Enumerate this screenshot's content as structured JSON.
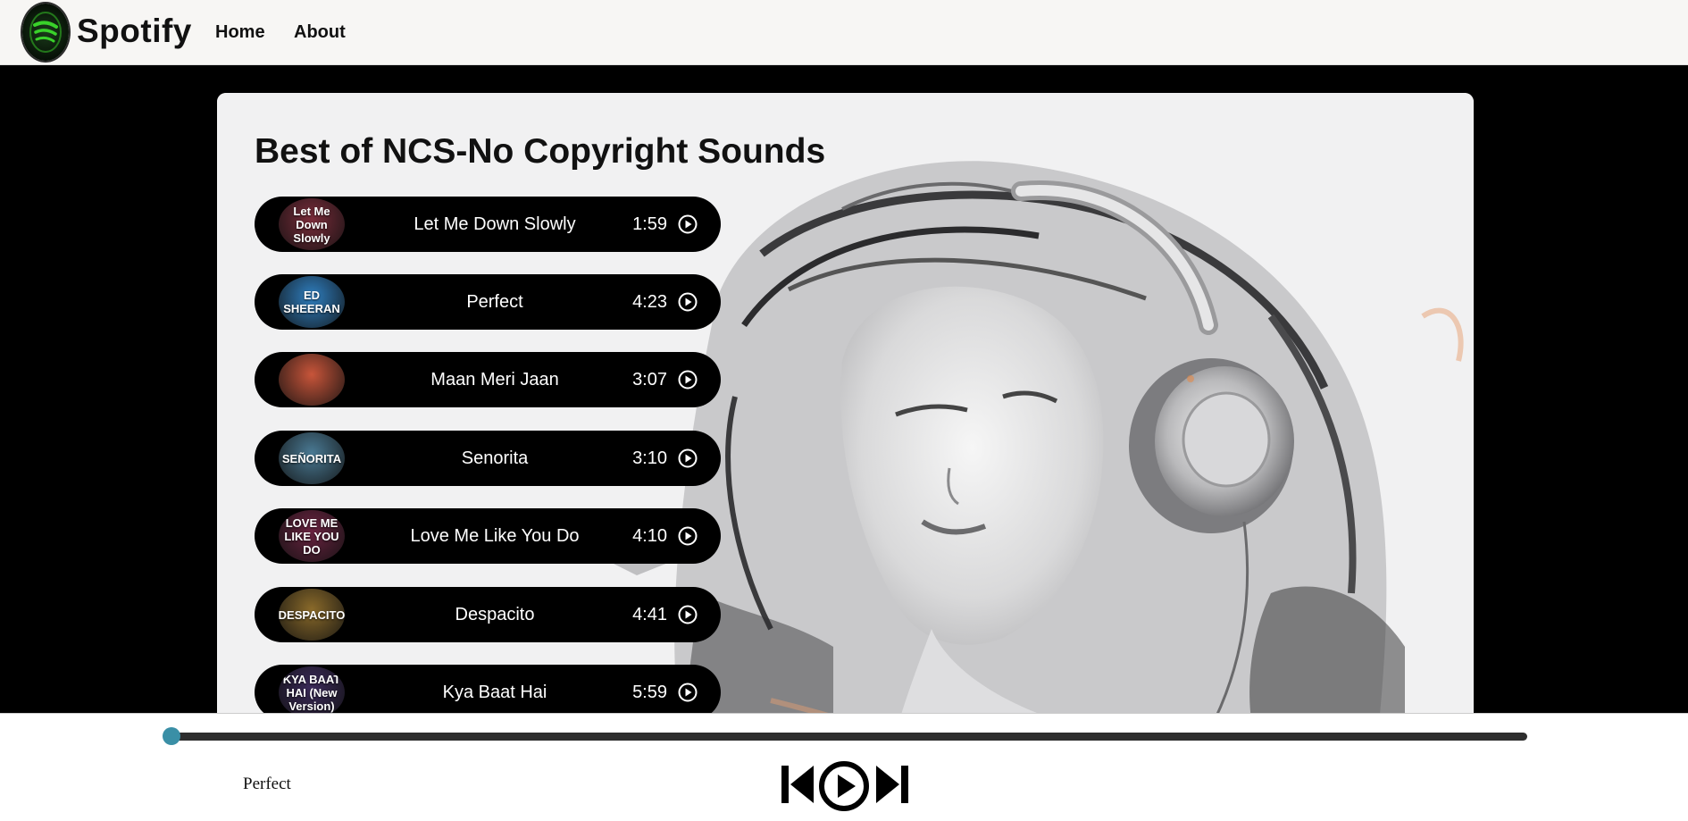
{
  "nav": {
    "brand": "Spotify",
    "links": [
      "Home",
      "About"
    ]
  },
  "main": {
    "heading": "Best of NCS-No Copyright Sounds",
    "songs": [
      {
        "name": "Let Me Down Slowly",
        "duration": "1:59",
        "cover_text": "Let Me Down Slowly",
        "cover_color": "#7a2c3a"
      },
      {
        "name": "Perfect",
        "duration": "4:23",
        "cover_text": "ED SHEERAN",
        "cover_color": "#2f7fc0"
      },
      {
        "name": "Maan Meri Jaan",
        "duration": "3:07",
        "cover_text": "",
        "cover_color": "#c8553a"
      },
      {
        "name": "Senorita",
        "duration": "3:10",
        "cover_text": "SEÑORITA",
        "cover_color": "#4a7a94"
      },
      {
        "name": "Love Me Like You Do",
        "duration": "4:10",
        "cover_text": "LOVE ME LIKE YOU DO",
        "cover_color": "#6a2340"
      },
      {
        "name": "Despacito",
        "duration": "4:41",
        "cover_text": "DESPACITO",
        "cover_color": "#8a6a2a"
      },
      {
        "name": "Kya Baat Hai",
        "duration": "5:59",
        "cover_text": "KYA BAAT HAI (New Version)",
        "cover_color": "#3b2a5a"
      }
    ]
  },
  "player": {
    "now_playing": "Perfect",
    "progress": 0.0
  },
  "colors": {
    "accent": "#3a8fa6",
    "logo_green": "#39d12a",
    "nav_bg": "#f7f6f4"
  },
  "icons": [
    "spotify-logo-icon",
    "play-circle-icon",
    "previous-icon",
    "play-icon",
    "next-icon"
  ]
}
